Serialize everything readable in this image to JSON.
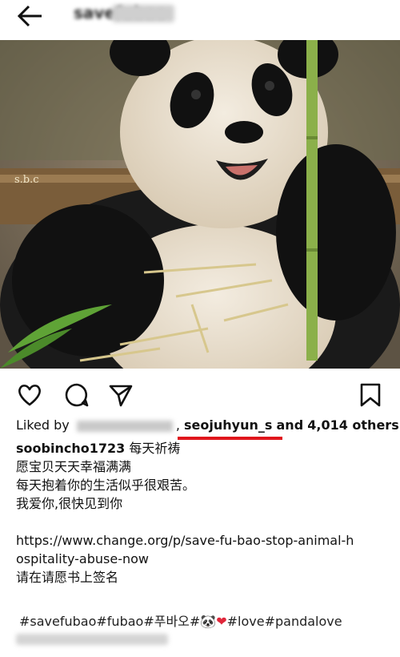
{
  "header": {
    "username": "savefubao",
    "back_icon": "arrow-left-icon"
  },
  "actions": {
    "like_icon": "heart-icon",
    "comment_icon": "comment-icon",
    "share_icon": "send-icon",
    "save_icon": "bookmark-icon"
  },
  "likes": {
    "prefix": "Liked by",
    "highlighted_user": "seojuhyun_s",
    "connector": "and",
    "count": "4,014 others"
  },
  "caption": {
    "owner": "soobincho1723",
    "line1_rest": " 每天祈祷",
    "line2": "愿宝贝天天幸福满满",
    "line3": "每天抱着你的生活似乎很艰苦。",
    "line4": "我爱你,很快见到你",
    "link_line1": "https://www.change.org/p/save-fu-bao-stop-animal-h",
    "link_line2": "ospitality-abuse-now",
    "sign_line": "请在请愿书上签名",
    "hashtags_a": "#savefubao#fubao#푸바오#",
    "hashtags_b": "#love#pandalove"
  },
  "photo": {
    "watermark": "s.b.c"
  },
  "colors": {
    "underline": "#e0161c",
    "heart": "#e0263a"
  }
}
